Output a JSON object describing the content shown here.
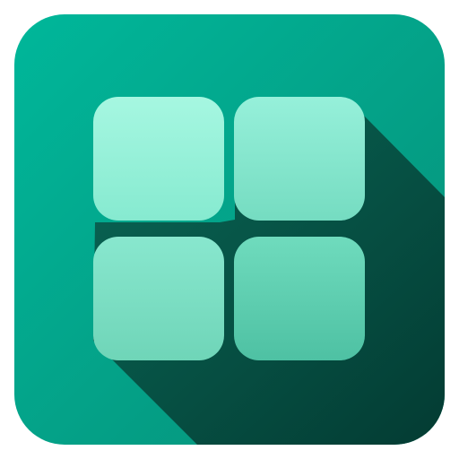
{
  "app_icon": {
    "icon_name": "app-grid-icon",
    "tiles": [
      {
        "position": "top-left",
        "color_top": "#a3f7df",
        "color_bottom": "#86ecd0"
      },
      {
        "position": "top-right",
        "color_top": "#93f0d8",
        "color_bottom": "#78dec3"
      },
      {
        "position": "bottom-left",
        "color_top": "#86e6cd",
        "color_bottom": "#6ed6b8"
      },
      {
        "position": "bottom-right",
        "color_top": "#6bd7b9",
        "color_bottom": "#52c3a6"
      }
    ],
    "colors": {
      "tile_background_top": "#00b58f",
      "tile_background_bottom": "#078e78",
      "long_shadow": "#05463a"
    }
  }
}
